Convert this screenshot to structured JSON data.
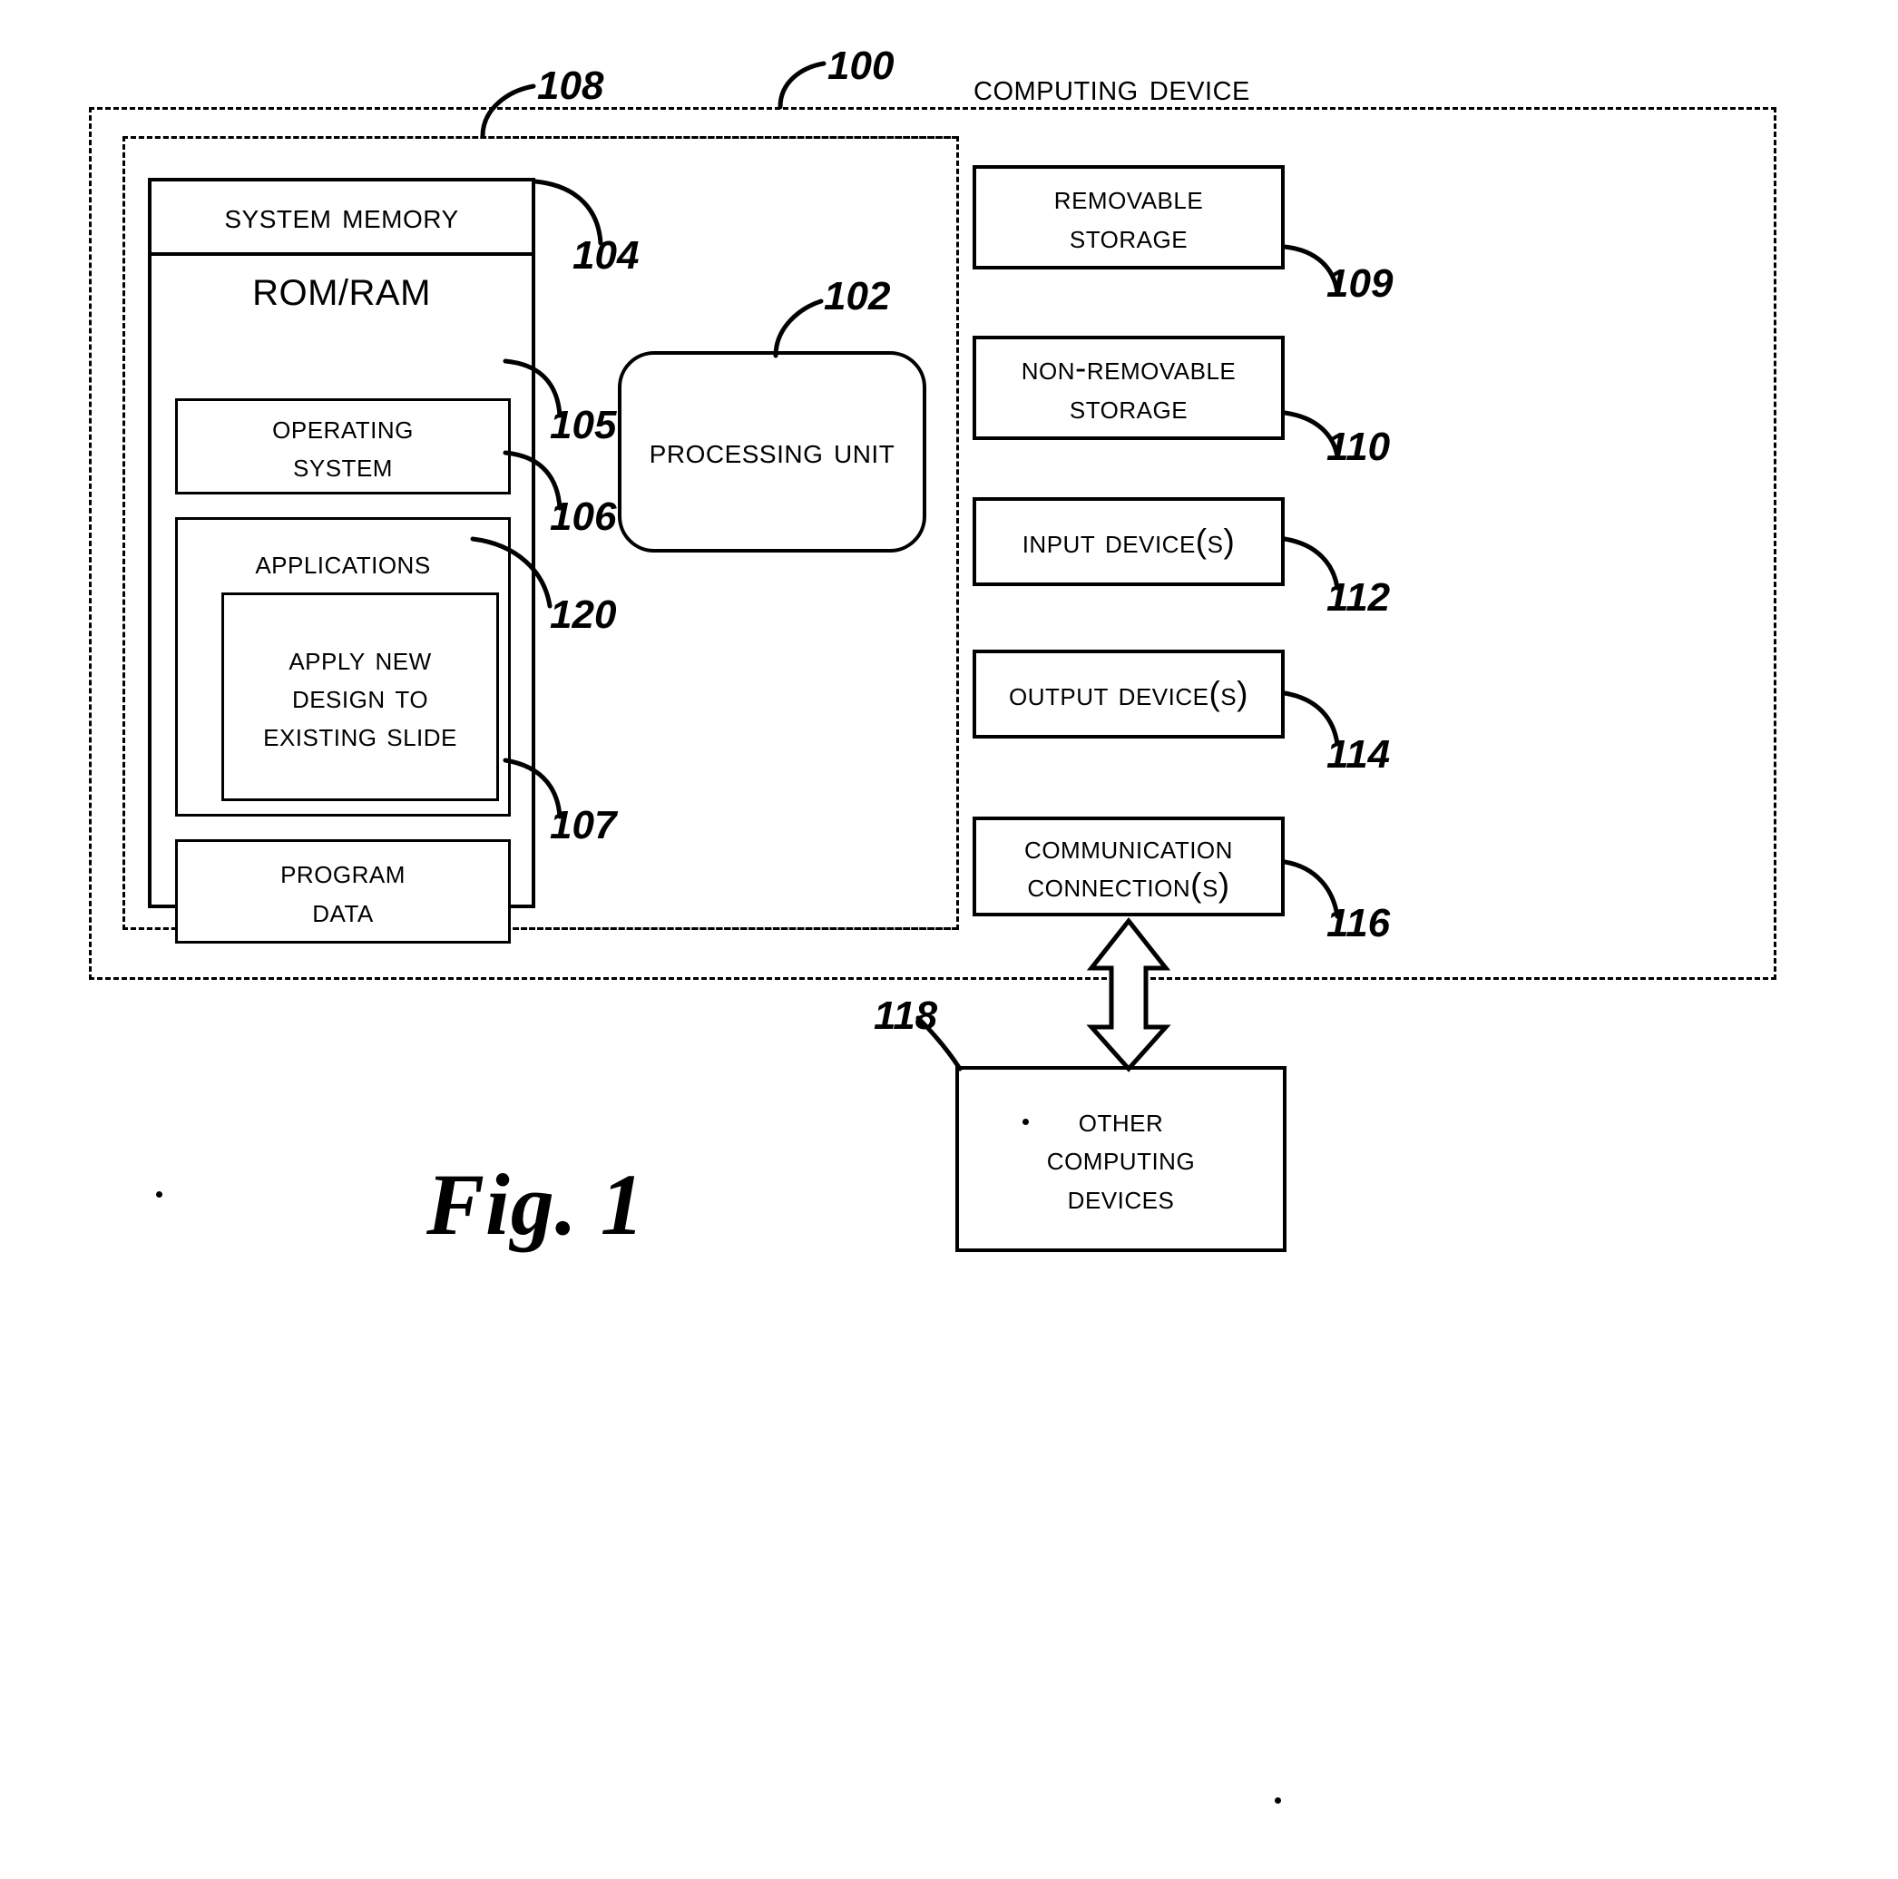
{
  "figure": {
    "caption": "Fig. 1",
    "title": "Computing Device",
    "title_ref": "100"
  },
  "outer_enclosure": {
    "name": "computing-device-boundary",
    "ref": "100"
  },
  "inner_enclosure": {
    "name": "basic-configuration-boundary",
    "ref": "108"
  },
  "memory": {
    "system_memory_label": "System Memory",
    "system_memory_ref": "104",
    "rom_ram_label": "ROM/RAM",
    "blocks": [
      {
        "label": "Operating System",
        "lines": [
          "Operating",
          "System"
        ],
        "ref": "105"
      },
      {
        "label": "Applications",
        "lines": [
          "Applications"
        ],
        "ref": "106"
      },
      {
        "label": "Apply New Design to Existing Slide",
        "lines": [
          "Apply New",
          "Design to",
          "Existing Slide"
        ],
        "ref": "120"
      },
      {
        "label": "Program Data",
        "lines": [
          "Program",
          "Data"
        ],
        "ref": "107"
      }
    ]
  },
  "processing_unit": {
    "label": "Processing Unit",
    "ref": "102"
  },
  "peripherals": [
    {
      "label": "Removable Storage",
      "lines": [
        "Removable",
        "Storage"
      ],
      "ref": "109"
    },
    {
      "label": "Non-Removable Storage",
      "lines": [
        "Non-Removable",
        "Storage"
      ],
      "ref": "110"
    },
    {
      "label": "Input Device(s)",
      "lines": [
        "Input Device(s)"
      ],
      "ref": "112"
    },
    {
      "label": "Output Device(s)",
      "lines": [
        "Output Device(s)"
      ],
      "ref": "114"
    },
    {
      "label": "Communication Connection(s)",
      "lines": [
        "Communication",
        "Connection(s)"
      ],
      "ref": "116"
    }
  ],
  "other_devices": {
    "label": "Other Computing Devices",
    "lines": [
      "Other",
      "Computing",
      "Devices"
    ],
    "ref": "118"
  },
  "connector": {
    "name": "bidirectional-arrow"
  },
  "colors": {
    "stroke": "#000000",
    "background": "#ffffff"
  }
}
